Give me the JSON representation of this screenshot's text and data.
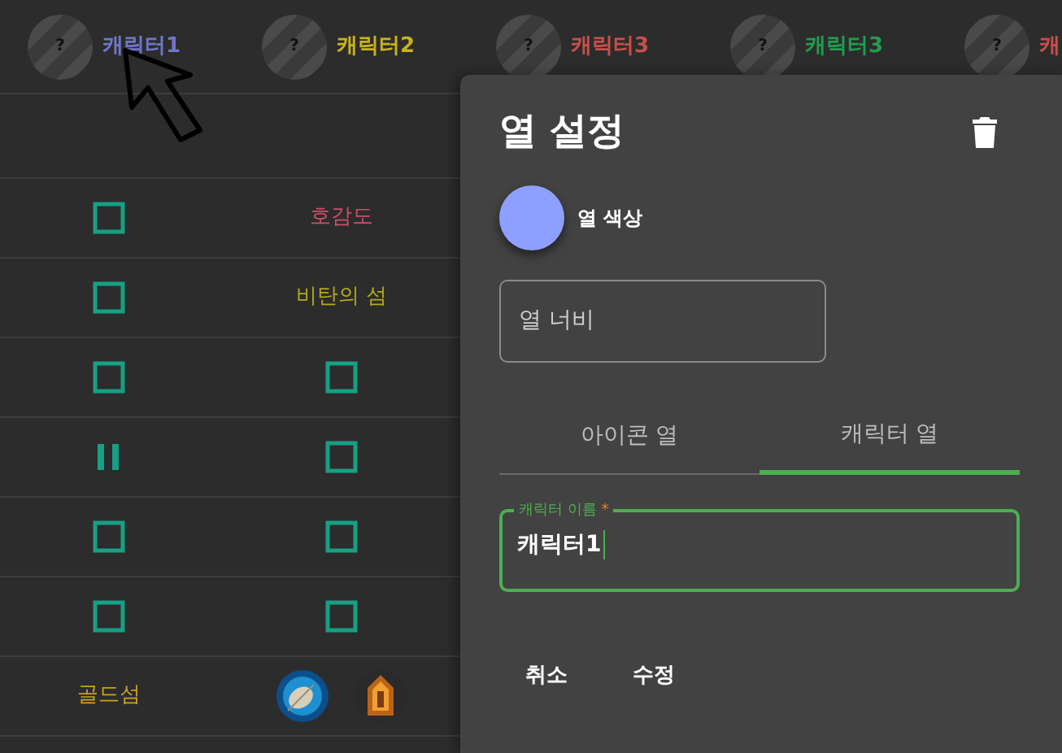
{
  "columns": [
    {
      "avatar": "?",
      "label": "캐릭터1",
      "color": "#6f76c8"
    },
    {
      "avatar": "?",
      "label": "캐릭터2",
      "color": "#c9b21c"
    },
    {
      "avatar": "?",
      "label": "캐릭터3",
      "color": "#c8504a"
    },
    {
      "avatar": "?",
      "label": "캐릭터3",
      "color": "#1f9d4e"
    },
    {
      "avatar": "?",
      "label": "캐",
      "color": "#c8504a"
    }
  ],
  "rows": [
    [
      {
        "kind": "checkbox",
        "checked": false
      },
      {
        "kind": "text",
        "text": "호감도",
        "color": "#c8506a"
      }
    ],
    [
      {
        "kind": "checkbox",
        "checked": false
      },
      {
        "kind": "text",
        "text": "비탄의 섬",
        "color": "#b5a81c"
      }
    ],
    [
      {
        "kind": "checkbox",
        "checked": false
      },
      {
        "kind": "checkbox",
        "checked": false
      }
    ],
    [
      {
        "kind": "pause"
      },
      {
        "kind": "checkbox",
        "checked": false
      }
    ],
    [
      {
        "kind": "checkbox",
        "checked": false
      },
      {
        "kind": "checkbox",
        "checked": false
      }
    ],
    [
      {
        "kind": "checkbox",
        "checked": false
      },
      {
        "kind": "checkbox",
        "checked": false
      }
    ],
    [
      {
        "kind": "text",
        "text": "골드섬",
        "color": "#c9a21c"
      },
      {
        "kind": "icons"
      }
    ]
  ],
  "dialog": {
    "title": "열 설정",
    "color_label": "열 색상",
    "color": "#8ea0ff",
    "width_field": {
      "placeholder": "열 너비"
    },
    "tabs": [
      {
        "label": "아이콘 열",
        "selected": false
      },
      {
        "label": "캐릭터 열",
        "selected": true
      }
    ],
    "name_field": {
      "label": "캐릭터 이름",
      "required_mark": "*",
      "value": "캐릭터1"
    },
    "buttons": [
      "취소",
      "수정"
    ]
  }
}
